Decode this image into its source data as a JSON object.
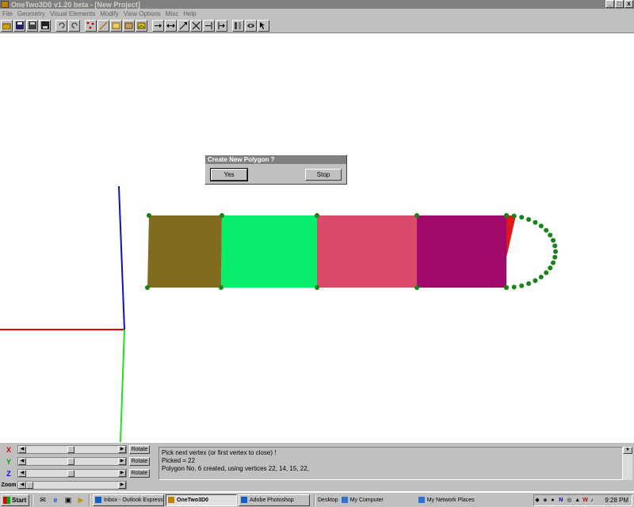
{
  "window": {
    "title": "OneTwo3D0 v1.20 beta - [New Project]",
    "controls": [
      "_",
      "□",
      "x"
    ]
  },
  "menu": [
    "File",
    "Geometry",
    "Visual Elements",
    "Modify",
    "View Options",
    "Misc",
    "Help"
  ],
  "toolbar": {
    "groups": [
      [
        "open-icon",
        "save-icon",
        "export-icon",
        "save-as-icon"
      ],
      [
        "undo-icon",
        "redo-icon"
      ],
      [
        "vertex-tool-icon",
        "line-tool-icon",
        "polygon-tool-icon",
        "texture-tool-icon",
        "image-tool-icon"
      ],
      [
        "move-icon",
        "move-both-icon",
        "rotate-icon",
        "scale-icon",
        "align-icon",
        "snap-icon"
      ],
      [
        "view-icon",
        "camera-icon",
        "select-icon"
      ]
    ]
  },
  "dialog": {
    "title": "Create New Polygon ?",
    "yes_label": "Yes",
    "stop_label": "Stop"
  },
  "scene": {
    "polygons": [
      {
        "name": "polygon-brown",
        "color": "#836B1E"
      },
      {
        "name": "polygon-green",
        "color": "#06ED6C"
      },
      {
        "name": "polygon-pink",
        "color": "#DD4A69"
      },
      {
        "name": "polygon-purple",
        "color": "#A1096A"
      },
      {
        "name": "polygon-red-sliver",
        "color": "#E01818"
      }
    ],
    "vertex_color": "#168416",
    "axis_colors": {
      "x": "#E00000",
      "y": "#22DD22",
      "z": "#1010C0"
    }
  },
  "controls": {
    "axes": [
      {
        "label": "X",
        "color": "#E00000",
        "button": "Rotate"
      },
      {
        "label": "Y",
        "color": "#00A000",
        "button": "Rotate"
      },
      {
        "label": "Z",
        "color": "#0000E0",
        "button": "Rotate"
      }
    ],
    "zoom_label": "Zoom"
  },
  "log": {
    "lines": [
      "Pick next vertex (or first vertex to close) !",
      "Picked = 22",
      "Polygon No. 6 created, using vertices 22, 14, 15, 22,"
    ]
  },
  "taskbar": {
    "start_label": "Start",
    "tasks": [
      {
        "label": "Inbox - Outlook Express",
        "active": false
      },
      {
        "label": "OneTwo3D0",
        "active": true
      },
      {
        "label": "Adobe Photoshop",
        "active": false
      }
    ],
    "links": [
      "Desktop",
      "My Computer",
      "My Network Places"
    ],
    "clock": "9:28 PM"
  }
}
